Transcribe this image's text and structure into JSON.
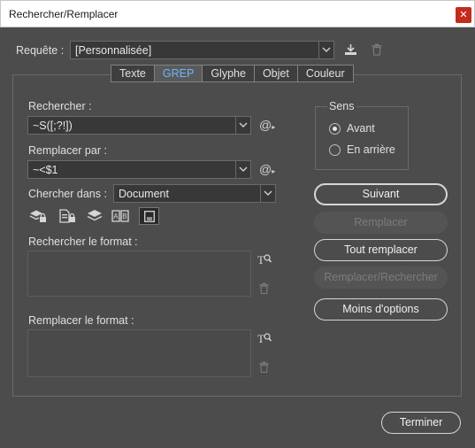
{
  "window": {
    "title": "Rechercher/Remplacer",
    "close_glyph": "✕"
  },
  "query": {
    "label": "Requête :",
    "value": "[Personnalisée]",
    "save_icon": "save-query-icon",
    "delete_icon": "trash-icon"
  },
  "tabs": [
    {
      "label": "Texte",
      "active": false
    },
    {
      "label": "GREP",
      "active": true
    },
    {
      "label": "Glyphe",
      "active": false
    },
    {
      "label": "Objet",
      "active": false
    },
    {
      "label": "Couleur",
      "active": false
    }
  ],
  "search": {
    "label": "Rechercher :",
    "value": "~S([;?!])"
  },
  "replace": {
    "label": "Remplacer par :",
    "value": "~<$1"
  },
  "scope": {
    "label": "Chercher dans :",
    "value": "Document"
  },
  "find_format": {
    "label": "Rechercher le format :"
  },
  "replace_format": {
    "label": "Remplacer le format :"
  },
  "direction": {
    "legend": "Sens",
    "options": [
      {
        "label": "Avant",
        "checked": true
      },
      {
        "label": "En arrière",
        "checked": false
      }
    ]
  },
  "buttons": {
    "next": "Suivant",
    "replace": "Remplacer",
    "replace_all": "Tout remplacer",
    "replace_find": "Remplacer/Rechercher",
    "fewer_options": "Moins d'options",
    "done": "Terminer"
  },
  "colors": {
    "background": "#4c4c4c",
    "accent": "#6cb6ff",
    "close": "#c42b1c"
  }
}
